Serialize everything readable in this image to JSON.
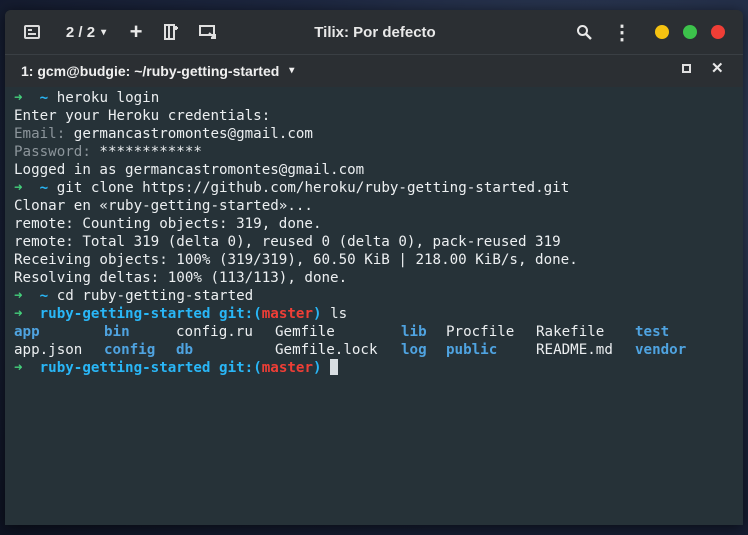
{
  "window": {
    "title": "Tilix: Por defecto",
    "session_counter": "2 / 2",
    "tab_title": "1: gcm@budgie: ~/ruby-getting-started"
  },
  "icons": {
    "session": "sidebar-icon",
    "add": "+",
    "split": "split-icon",
    "sync": "sync-input-icon",
    "search": "search-icon",
    "menu": "⋮",
    "caret": "▾",
    "maximize": "maximize-icon",
    "close": "✕"
  },
  "colors": {
    "prompt_arrow": "#44d07b",
    "prompt_dir": "#29b6f6",
    "git_branch": "#ef3e36",
    "directory": "#4fa3e0",
    "minimize": "#f5c211",
    "maximize": "#3cc24b",
    "close": "#ef3e36"
  },
  "terminal": {
    "arrow": "➜",
    "home": "~",
    "cmd1": "heroku login",
    "out1": "Enter your Heroku credentials:",
    "email_label": "Email:",
    "email_value": "germancastromontes@gmail.com",
    "password_label": "Password:",
    "password_value": "************",
    "out2": "Logged in as germancastromontes@gmail.com",
    "cmd2": "git clone https://github.com/heroku/ruby-getting-started.git",
    "out3": "Clonar en «ruby-getting-started»...",
    "out4": "remote: Counting objects: 319, done.",
    "out5": "remote: Total 319 (delta 0), reused 0 (delta 0), pack-reused 319",
    "out6": "Receiving objects: 100% (319/319), 60.50 KiB | 218.00 KiB/s, done.",
    "out7": "Resolving deltas: 100% (113/113), done.",
    "cmd3": "cd ruby-getting-started",
    "prompt_dir": "ruby-getting-started",
    "git_prefix": "git:(",
    "branch": "master",
    "git_suffix": ")",
    "cmd4": "ls",
    "ls_row1": [
      "app",
      "bin",
      "config.ru",
      "Gemfile",
      "lib",
      "Procfile",
      "Rakefile",
      "test"
    ],
    "ls_row2": [
      "app.json",
      "config",
      "db",
      "Gemfile.lock",
      "log",
      "public",
      "README.md",
      "vendor"
    ]
  }
}
